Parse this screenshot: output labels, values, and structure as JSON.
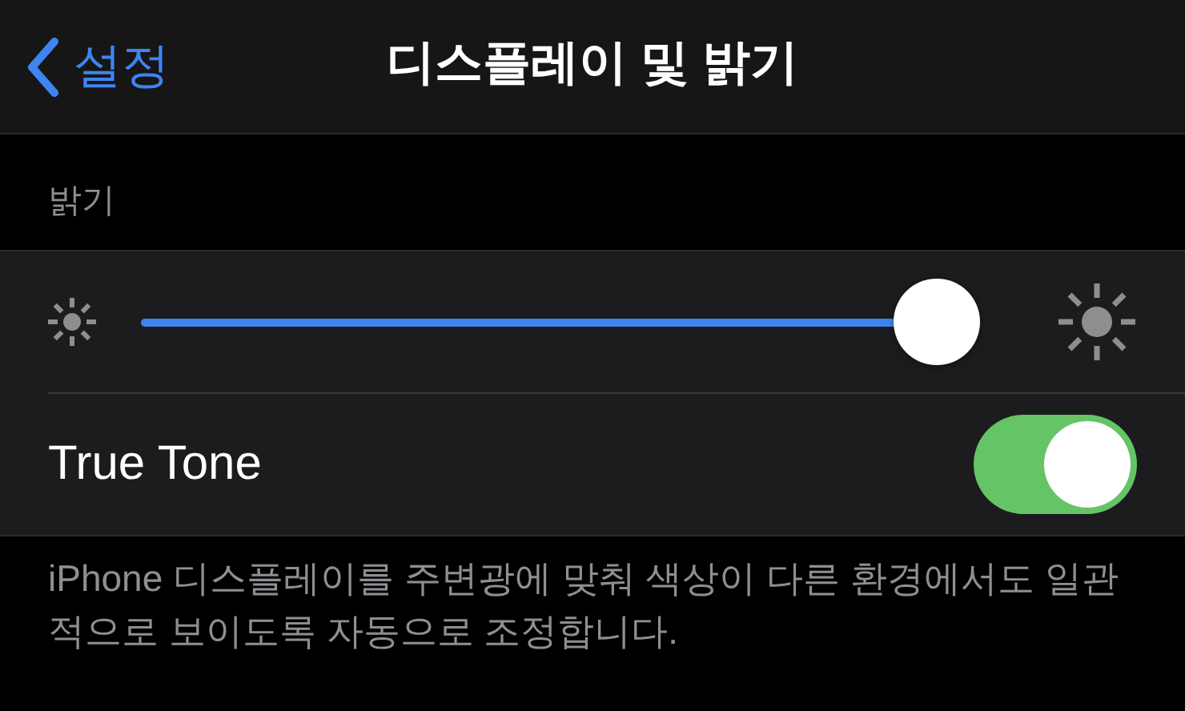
{
  "nav_bar": {
    "back_label": "설정",
    "title": "디스플레이 및 밝기"
  },
  "section_header": "밝기",
  "brightness": {
    "level": 1.0
  },
  "true_tone": {
    "label": "True Tone",
    "on": true
  },
  "footer": "iPhone 디스플레이를 주변광에 맞춰 색상이 다른 환경에서도 일관적으로 보이도록 자동으로 조정합니다."
}
